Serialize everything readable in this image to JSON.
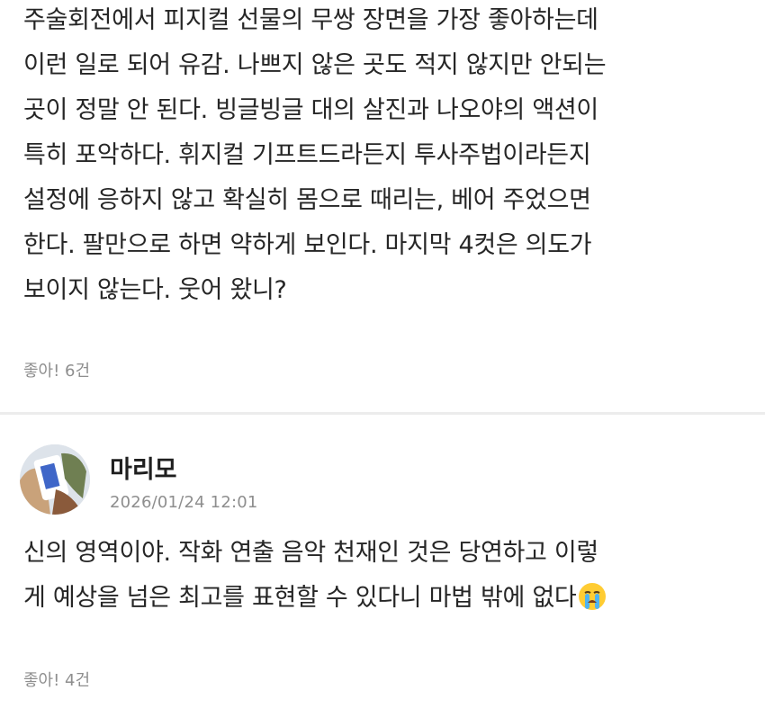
{
  "comments": [
    {
      "lines": [
        "주술회전에서 피지컬 선물의 무쌍 장면을 가장 좋아하는데",
        "이런 일로 되어 유감. 나쁘지 않은 곳도 적지 않지만 안되는",
        "곳이 정말 안 된다. 빙글빙글 대의 살진과 나오야의 액션이",
        "특히 포악하다. 휘지컬 기프트드라든지 투사주법이라든지",
        "설정에 응하지 않고 확실히 몸으로 때리는, 베어 주었으면",
        "한다. 팔만으로 하면 약하게 보인다. 마지막 4컷은 의도가",
        "보이지 않는다. 웃어 왔니?"
      ],
      "like_label": "좋아! 6건"
    },
    {
      "author": "마리모",
      "timestamp": "2026/01/24 12:01",
      "lines": [
        "신의 영역이야. 작화 연출 음악 천재인 것은 당연하고 이렇",
        "게 예상을 넘은 최고를 표현할 수 있다니 마법 밖에 없다"
      ],
      "trailing_icon": "crying-face-emoji-icon",
      "like_label": "좋아! 4건"
    }
  ],
  "colors": {
    "text": "#262626",
    "meta": "#8e8e8e",
    "divider": "#ececec",
    "background": "#ffffff"
  }
}
